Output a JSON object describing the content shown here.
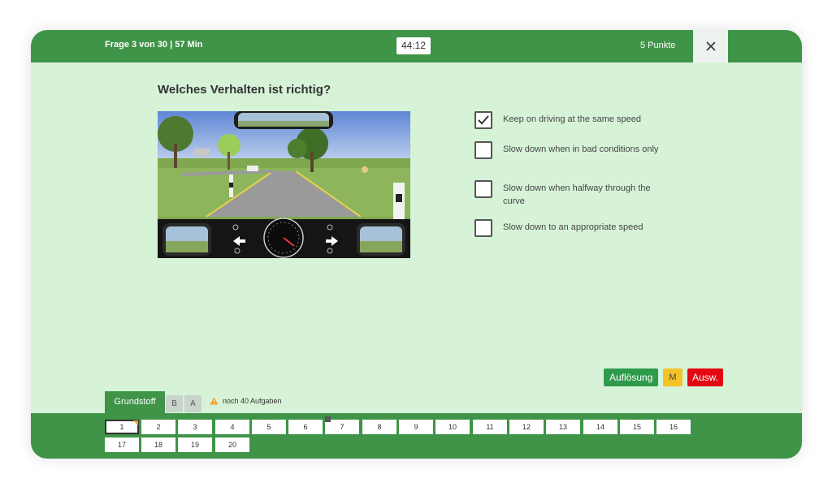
{
  "header": {
    "progress": "Frage 3 von 30 | 57 Min",
    "timer": "44:12",
    "points": "5 Punkte",
    "close_glyph": "✕"
  },
  "question": {
    "title": "Welches Verhalten ist richtig?"
  },
  "answers": [
    {
      "text": "Keep on driving at the same speed",
      "checked": true
    },
    {
      "text": "Slow down when in bad conditions only",
      "checked": false
    },
    {
      "text": "Slow down when halfway through the curve",
      "checked": false
    },
    {
      "text": "Slow down to an appropriate speed",
      "checked": false
    }
  ],
  "actions": {
    "solution": "Auflösung",
    "mark": "M",
    "evaluate": "Ausw."
  },
  "category_tabs": {
    "basic": "Grundstoff",
    "b": "B",
    "a": "A",
    "remaining": "noch 40 Aufgaben"
  },
  "question_nav": [
    "1",
    "2",
    "3",
    "4",
    "5",
    "6",
    "7",
    "8",
    "9",
    "10",
    "11",
    "12",
    "13",
    "14",
    "15",
    "16",
    "17",
    "18",
    "19",
    "20"
  ],
  "colors": {
    "primary_green": "#3f9447",
    "background": "#d6f3d8",
    "solution_green": "#2e9a4c",
    "mark_yellow": "#f4c32a",
    "evaluate_red": "#e30613"
  }
}
